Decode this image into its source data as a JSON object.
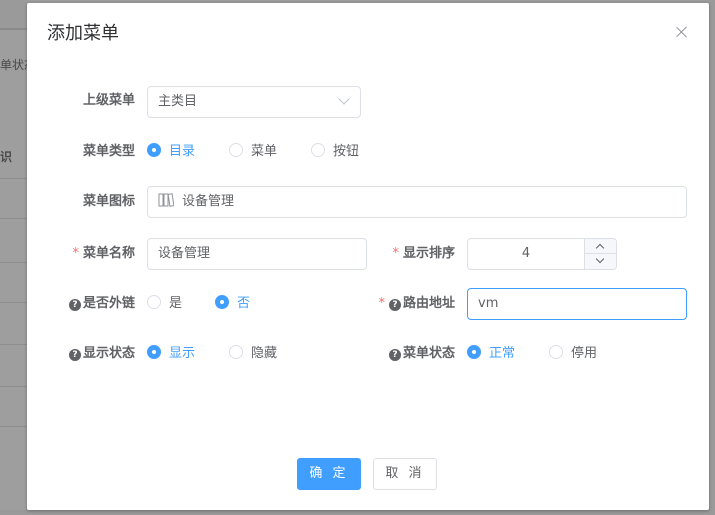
{
  "background": {
    "fragment_1": "单状态",
    "fragment_2": "识"
  },
  "dialog": {
    "title": "添加菜单",
    "close_icon": "close-icon"
  },
  "form": {
    "parent_menu": {
      "label": "上级菜单",
      "value": "主类目"
    },
    "menu_type": {
      "label": "菜单类型",
      "options": [
        "目录",
        "菜单",
        "按钮"
      ],
      "selected": "目录"
    },
    "menu_icon": {
      "label": "菜单图标",
      "icon": "book-icon",
      "value": "设备管理"
    },
    "menu_name": {
      "label": "菜单名称",
      "value": "设备管理",
      "required": "*"
    },
    "display_order": {
      "label": "显示排序",
      "value": "4",
      "required": "*"
    },
    "is_external": {
      "label": "是否外链",
      "options": [
        "是",
        "否"
      ],
      "selected": "否"
    },
    "route_path": {
      "label": "路由地址",
      "value": "vm",
      "required": "*"
    },
    "display_status": {
      "label": "显示状态",
      "options": [
        "显示",
        "隐藏"
      ],
      "selected": "显示"
    },
    "menu_status": {
      "label": "菜单状态",
      "options": [
        "正常",
        "停用"
      ],
      "selected": "正常"
    }
  },
  "footer": {
    "confirm_label": "确 定",
    "cancel_label": "取 消"
  },
  "colors": {
    "primary": "#409eff",
    "required": "#f56c6c",
    "border": "#dcdfe6"
  }
}
